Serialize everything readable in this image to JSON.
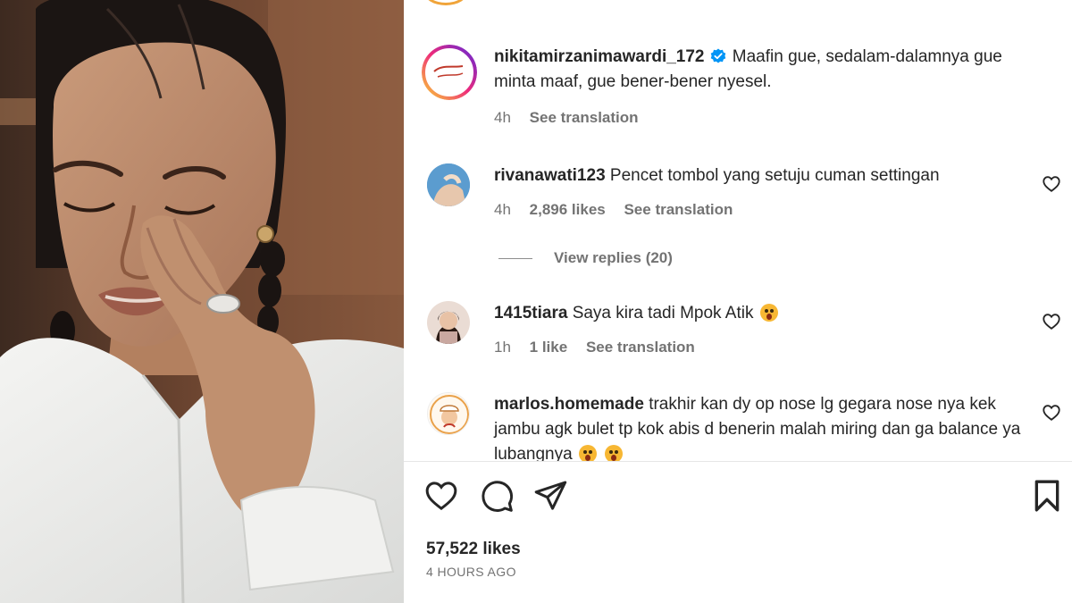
{
  "post": {
    "caption": {
      "username": "nikitamirzanimawardi_172",
      "verified": true,
      "text": "Maafin gue, sedalam-dalamnya gue minta maaf, gue bener-bener nyesel.",
      "time": "4h",
      "see_translation": "See translation"
    },
    "comments": [
      {
        "username": "rivanawati123",
        "text": "Pencet tombol yang setuju cuman settingan",
        "time": "4h",
        "likes": "2,896 likes",
        "see_translation": "See translation",
        "view_replies": "View replies (20)"
      },
      {
        "username": "1415tiara",
        "text": "Saya kira tadi Mpok Atik",
        "emoji": "astonished-face",
        "time": "1h",
        "likes": "1 like",
        "see_translation": "See translation"
      },
      {
        "username": "marlos.homemade",
        "text_line1": "trakhir kan dy op nose lg gegara nose nya",
        "text_line2": "kek jambu agk bulet tp kok abis d benerin malah miring dan ga",
        "text_line3": "balance ya lubangnya",
        "emoji": "astonished-face"
      }
    ],
    "likes_total": "57,522 likes",
    "timestamp": "4 HOURS AGO"
  },
  "icons": {
    "like": "heart-icon",
    "comment": "comment-bubble-icon",
    "share": "paper-plane-icon",
    "save": "bookmark-icon",
    "verified": "verified-badge-icon",
    "comment_like": "small-heart-icon"
  },
  "colors": {
    "verified_blue": "#0095f6",
    "text_primary": "#262626",
    "text_secondary": "#737373",
    "story_ring_start": "#f9ce34",
    "story_ring_mid": "#ee2a7b",
    "story_ring_end": "#6228d7"
  }
}
